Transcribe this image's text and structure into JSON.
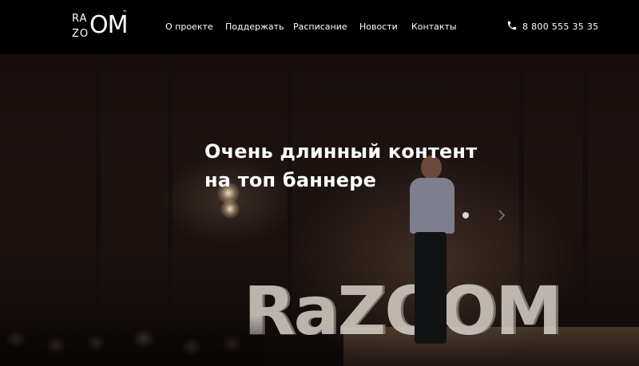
{
  "logo": {
    "line1": "RA",
    "line2": "ZO",
    "mark": "OM"
  },
  "nav": {
    "items": [
      {
        "label": "О проекте"
      },
      {
        "label": "Поддержать"
      },
      {
        "label": "Расписание"
      },
      {
        "label": "Новости"
      },
      {
        "label": "Контакты"
      }
    ]
  },
  "phone": {
    "icon": "phone-icon",
    "number": "8 800 555 35 35"
  },
  "banner": {
    "headline_line1": "Очень длинный контент",
    "headline_line2": "на топ баннере",
    "stage_sign": "RaZOOM",
    "slides_total": 1,
    "active_slide": 1,
    "next_icon": "chevron-right-icon"
  },
  "colors": {
    "header_bg": "#000000",
    "text": "#ffffff",
    "dot": "#d8d8d8"
  }
}
